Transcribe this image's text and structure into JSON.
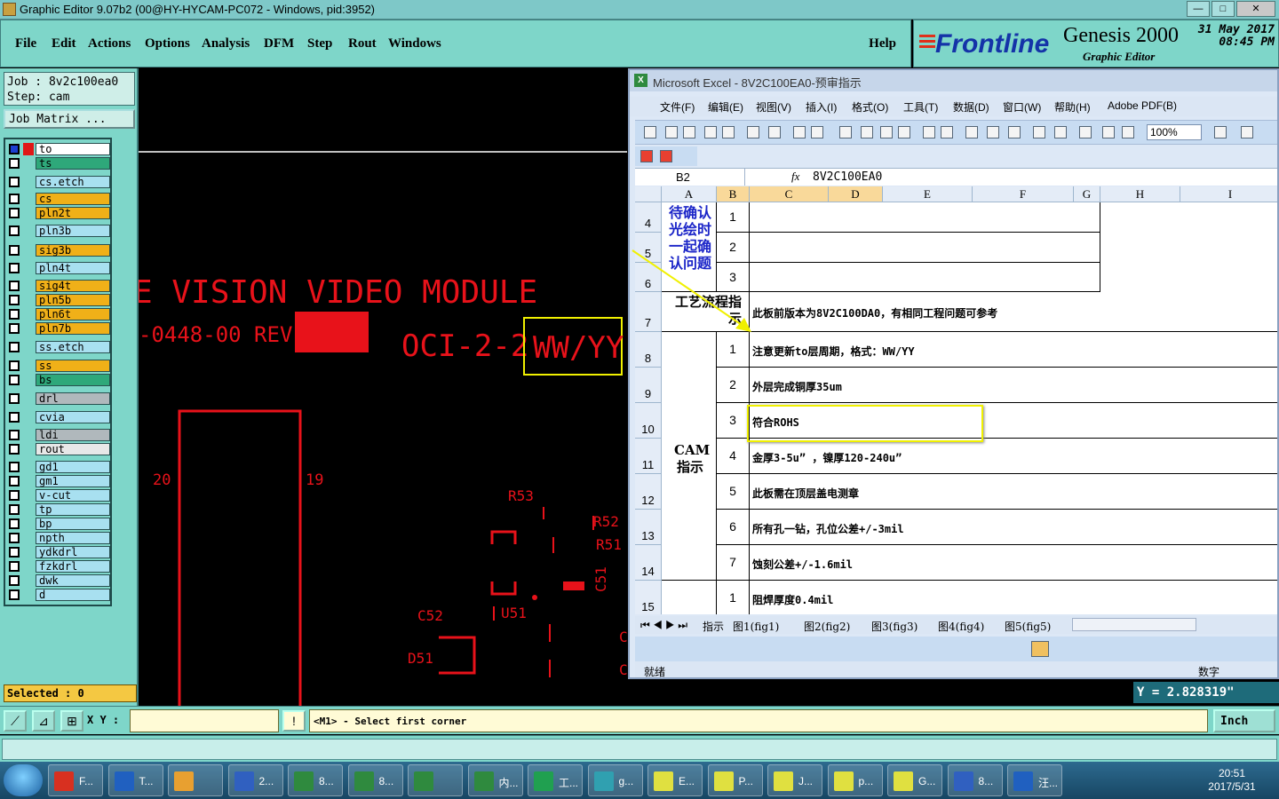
{
  "window": {
    "title": "Graphic Editor 9.07b2 (00@HY-HYCAM-PC072 - Windows, pid:3952)",
    "buttons": [
      "—",
      "□",
      "✕"
    ]
  },
  "menu": [
    "File",
    "Edit",
    "Actions",
    "Options",
    "Analysis",
    "DFM",
    "Step",
    "Rout",
    "Windows"
  ],
  "help": "Help",
  "brand": {
    "logo": "Frontline",
    "product": "Genesis 2000",
    "subtitle": "Graphic Editor",
    "date": "31 May 2017",
    "time": "08:45 PM"
  },
  "job": {
    "job_line": "Job : 8v2c100ea0",
    "step_line": "Step: cam",
    "matrix_btn": "Job Matrix ..."
  },
  "layers": [
    {
      "name": "to",
      "color": "#ffffff",
      "active": true
    },
    {
      "name": "ts",
      "color": "#2ea87a"
    },
    {
      "name": "cs.etch",
      "color": "#a8e0f0"
    },
    {
      "name": "cs",
      "color": "#f0b018"
    },
    {
      "name": "pln2t",
      "color": "#f0b018"
    },
    {
      "name": "pln3b",
      "color": "#a8e0f0"
    },
    {
      "name": "sig3b",
      "color": "#f0b018"
    },
    {
      "name": "pln4t",
      "color": "#a8e0f0"
    },
    {
      "name": "sig4t",
      "color": "#f0b018"
    },
    {
      "name": "pln5b",
      "color": "#f0b018"
    },
    {
      "name": "pln6t",
      "color": "#f0b018"
    },
    {
      "name": "pln7b",
      "color": "#f0b018"
    },
    {
      "name": "ss.etch",
      "color": "#a8e0f0"
    },
    {
      "name": "ss",
      "color": "#f0b018"
    },
    {
      "name": "bs",
      "color": "#2ea87a"
    },
    {
      "name": "drl",
      "color": "#b0b8bc"
    },
    {
      "name": "cvia",
      "color": "#a8e0f0"
    },
    {
      "name": "ldi",
      "color": "#b0b8bc"
    },
    {
      "name": "rout",
      "color": "#e8e8e8"
    },
    {
      "name": "gd1",
      "color": "#a8e0f0"
    },
    {
      "name": "gm1",
      "color": "#a8e0f0"
    },
    {
      "name": "v-cut",
      "color": "#a8e0f0"
    },
    {
      "name": "tp",
      "color": "#a8e0f0"
    },
    {
      "name": "bp",
      "color": "#a8e0f0"
    },
    {
      "name": "npth",
      "color": "#a8e0f0"
    },
    {
      "name": "ydkdrl",
      "color": "#a8e0f0"
    },
    {
      "name": "fzkdrl",
      "color": "#a8e0f0"
    },
    {
      "name": "dwk",
      "color": "#a8e0f0"
    },
    {
      "name": "d",
      "color": "#a8e0f0"
    }
  ],
  "selected": "Selected : 0",
  "canvas": {
    "title": "E VISION VIDEO MODULE",
    "part": "-0448-00 REV",
    "oci": "OCI-2-2",
    "wwyy": "WW/YY",
    "pin20": "20",
    "pin19": "19",
    "refs": [
      "R53",
      "R52",
      "R51",
      "C51",
      "C52",
      "U51",
      "D51",
      "C",
      "C"
    ]
  },
  "excel": {
    "title": "Microsoft Excel - 8V2C100EA0-预审指示",
    "menu": [
      "文件(F)",
      "编辑(E)",
      "视图(V)",
      "插入(I)",
      "格式(O)",
      "工具(T)",
      "数据(D)",
      "窗口(W)",
      "帮助(H)",
      "Adobe PDF(B)"
    ],
    "zoom": "100%",
    "namebox": "B2",
    "fx": "fx",
    "formula": "8V2C100EA0",
    "columns": [
      "A",
      "B",
      "C",
      "D",
      "E",
      "F",
      "G",
      "H",
      "I"
    ],
    "rows": [
      "4",
      "5",
      "6",
      "7",
      "8",
      "9",
      "10",
      "11",
      "12",
      "13",
      "14",
      "15"
    ],
    "blue_note": "待确认光绘时一起确认问题",
    "blue_nums": [
      "1",
      "2",
      "3"
    ],
    "process_label": "工艺流程指示",
    "process_text": "此板前版本为8V2C100DA0，有相同工程问题可参考",
    "cam_label": "CAM指示",
    "items": [
      {
        "n": "1",
        "text": "注意更新to层周期，格式：WW/YY"
      },
      {
        "n": "2",
        "text": "外层完成铜厚35um"
      },
      {
        "n": "3",
        "text": "符合ROHS"
      },
      {
        "n": "4",
        "text": "金厚3-5u”  ，镍厚120-240u”"
      },
      {
        "n": "5",
        "text": "此板需在顶层盖电测章"
      },
      {
        "n": "6",
        "text": "所有孔一钻，孔位公差+/-3mil"
      },
      {
        "n": "7",
        "text": "蚀刻公差+/-1.6mil"
      },
      {
        "n": "1",
        "text": "阻焊厚度0.4mil"
      }
    ],
    "tabs": [
      "指示",
      "图1(fig1)",
      "图2(fig2)",
      "图3(fig3)",
      "图4(fig4)",
      "图5(fig5)"
    ],
    "status_left": "就绪",
    "status_right": "数字"
  },
  "coords": {
    "y": "Y = 2.828319\""
  },
  "command": {
    "xy_label": "X Y :",
    "prompt": "<M1> - Select first corner",
    "units": "Inch"
  },
  "taskbar": {
    "buttons": [
      {
        "label": "F...",
        "color": "#d83020"
      },
      {
        "label": "T...",
        "color": "#2060c0"
      },
      {
        "label": "",
        "color": "#e8a030"
      },
      {
        "label": "2...",
        "color": "#3060c0"
      },
      {
        "label": "8...",
        "color": "#2f8a3e"
      },
      {
        "label": "8...",
        "color": "#2f8a3e"
      },
      {
        "label": "",
        "color": "#2f8a3e"
      },
      {
        "label": "内...",
        "color": "#2f8a3e"
      },
      {
        "label": "工...",
        "color": "#20a050"
      },
      {
        "label": "g...",
        "color": "#30a0b0"
      },
      {
        "label": "E...",
        "color": "#e0e040"
      },
      {
        "label": "P...",
        "color": "#e0e040"
      },
      {
        "label": "J...",
        "color": "#e0e040"
      },
      {
        "label": "p...",
        "color": "#e0e040"
      },
      {
        "label": "G...",
        "color": "#e0e040"
      },
      {
        "label": "8...",
        "color": "#3060c0"
      },
      {
        "label": "汪...",
        "color": "#2060c0"
      }
    ],
    "time": "20:51",
    "date": "2017/5/31"
  }
}
